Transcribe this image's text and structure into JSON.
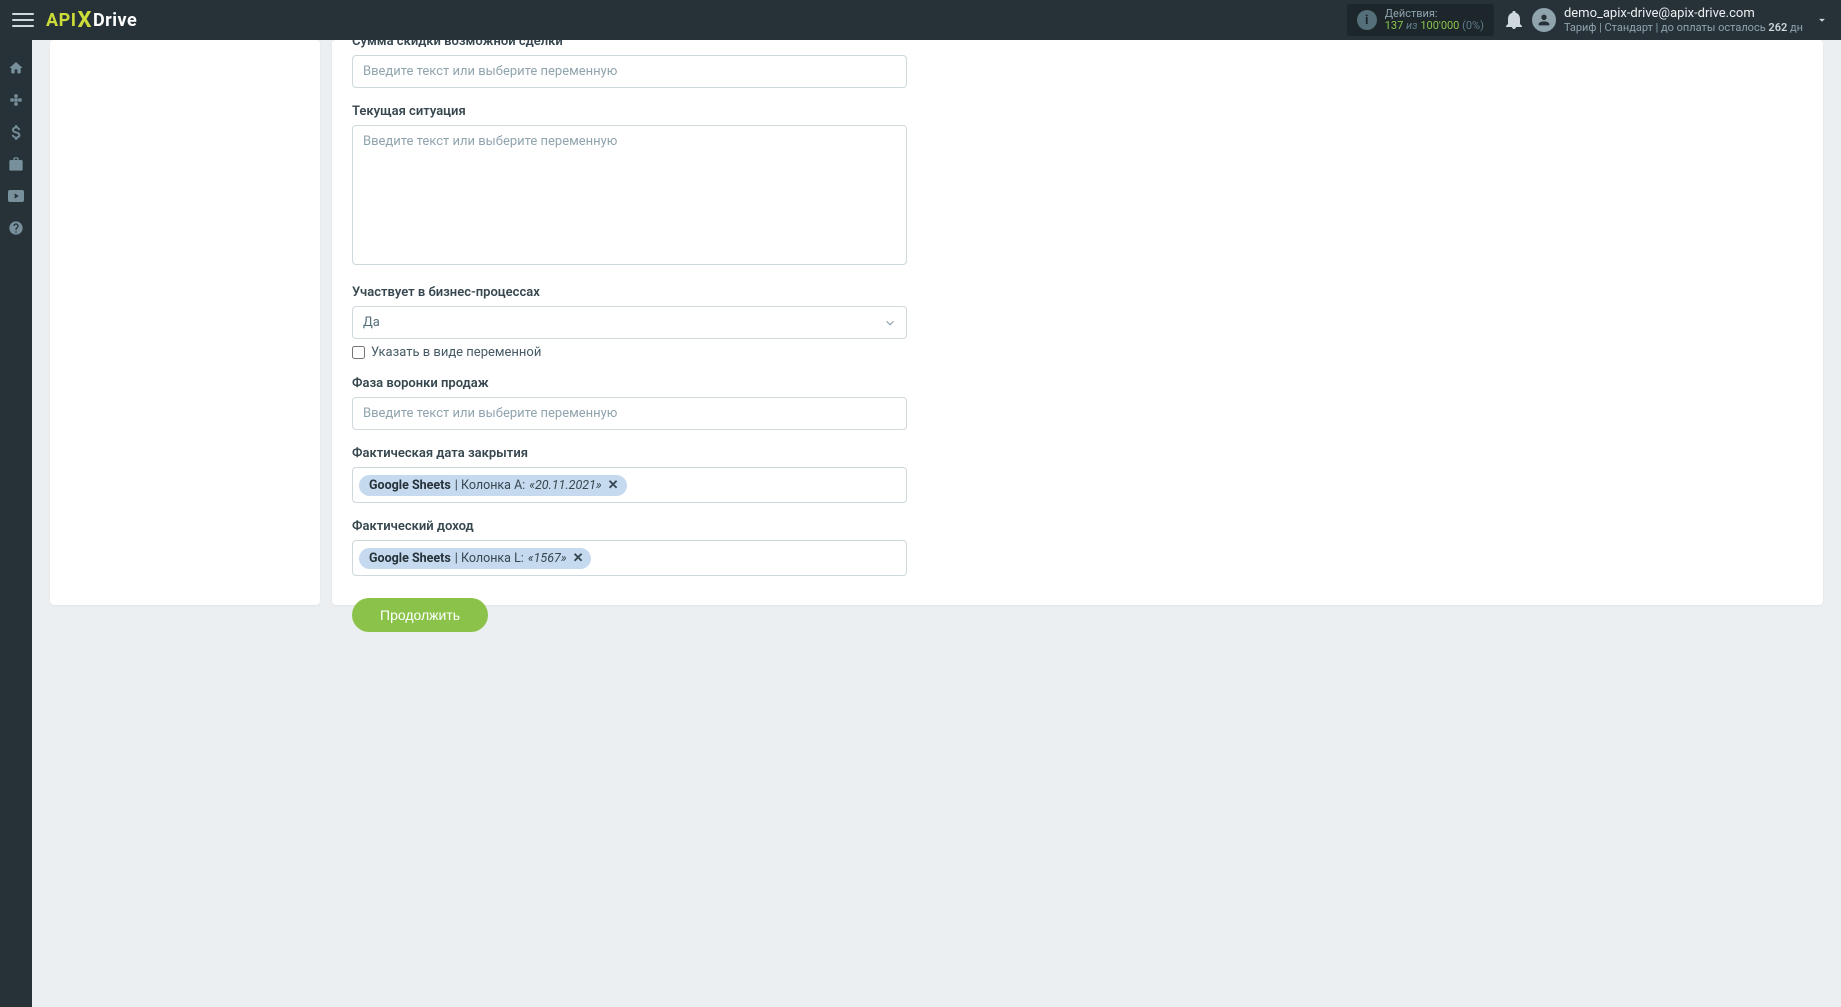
{
  "header": {
    "logo": {
      "api": "API",
      "x": "X",
      "drive": "Drive"
    },
    "actions": {
      "label": "Действия:",
      "num1": "137",
      "of": "из",
      "num2": "100'000",
      "pct": "(0%)"
    },
    "user": {
      "email": "demo_apix-drive@apix-drive.com",
      "tariff_prefix": "Тариф | Стандарт | до оплаты осталось ",
      "days": "262",
      "tariff_suffix": " дн"
    }
  },
  "form": {
    "discount_label": "Сумма скидки возможной сделки",
    "placeholder": "Введите текст или выберите переменную",
    "situation_label": "Текущая ситуация",
    "business_label": "Участвует в бизнес-процессах",
    "business_value": "Да",
    "variable_checkbox": "Указать в виде переменной",
    "funnel_label": "Фаза воронки продаж",
    "close_date_label": "Фактическая дата закрытия",
    "close_date_tag": {
      "src": "Google Sheets",
      "col": " | Колонка A: ",
      "val": "«20.11.2021»"
    },
    "income_label": "Фактический доход",
    "income_tag": {
      "src": "Google Sheets",
      "col": " | Колонка L: ",
      "val": "«1567»"
    },
    "continue": "Продолжить"
  }
}
